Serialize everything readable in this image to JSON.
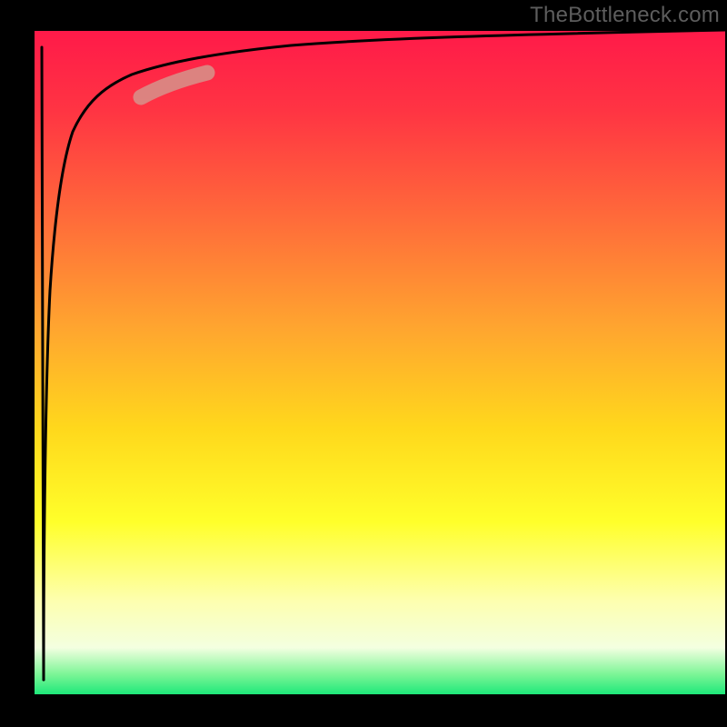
{
  "watermark": "TheBottleneck.com",
  "chart_data": {
    "type": "line",
    "title": "",
    "xlabel": "",
    "ylabel": "",
    "xlim": [
      0,
      100
    ],
    "ylim": [
      0,
      100
    ],
    "axes_visible": false,
    "background_gradient": {
      "stops": [
        {
          "offset": 0.0,
          "color": "#ff1a49"
        },
        {
          "offset": 0.12,
          "color": "#ff3443"
        },
        {
          "offset": 0.28,
          "color": "#ff6a3a"
        },
        {
          "offset": 0.45,
          "color": "#ffa62f"
        },
        {
          "offset": 0.6,
          "color": "#ffd81c"
        },
        {
          "offset": 0.74,
          "color": "#ffff2a"
        },
        {
          "offset": 0.86,
          "color": "#fdffb0"
        },
        {
          "offset": 0.93,
          "color": "#f3ffe0"
        },
        {
          "offset": 0.97,
          "color": "#7cf596"
        },
        {
          "offset": 1.0,
          "color": "#1ee87a"
        }
      ]
    },
    "series": [
      {
        "name": "curve",
        "type": "line",
        "color": "#000000",
        "x": [
          1.5,
          1.8,
          2.2,
          2.6,
          3.0,
          3.6,
          4.4,
          5.5,
          7.0,
          9.0,
          12.0,
          16.0,
          22.0,
          30.0,
          40.0,
          55.0,
          72.0,
          88.0,
          100.0
        ],
        "y": [
          2.0,
          30.0,
          50.0,
          62.0,
          70.0,
          76.0,
          81.0,
          84.5,
          87.3,
          89.3,
          91.0,
          92.4,
          93.6,
          94.6,
          95.4,
          96.2,
          96.8,
          97.2,
          97.5
        ]
      },
      {
        "name": "spike",
        "type": "line",
        "color": "#000000",
        "x": [
          1.0,
          1.5
        ],
        "y": [
          97.0,
          2.0
        ]
      },
      {
        "name": "highlight-segment",
        "type": "marker",
        "color": "#d98b85",
        "x_range": [
          15.5,
          25.0
        ],
        "y_range": [
          88.3,
          90.4
        ],
        "note": "rounded thick stroke overlay on the curve"
      }
    ]
  }
}
